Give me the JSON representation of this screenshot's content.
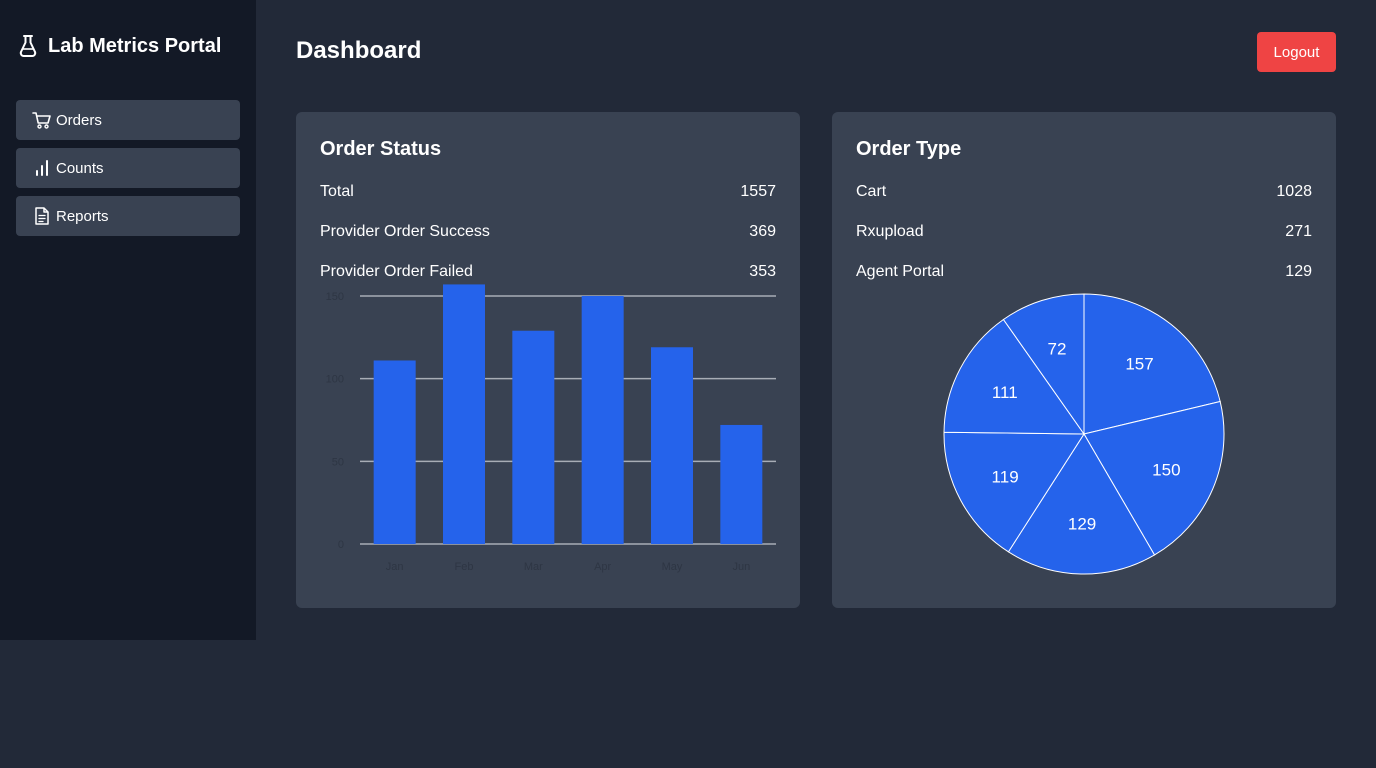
{
  "app": {
    "title": "Lab Metrics Portal",
    "logo_icon": "flask-icon"
  },
  "sidebar": {
    "items": [
      {
        "label": "Orders",
        "icon": "cart-icon"
      },
      {
        "label": "Counts",
        "icon": "bar-chart-icon"
      },
      {
        "label": "Reports",
        "icon": "document-icon"
      }
    ]
  },
  "header": {
    "title": "Dashboard",
    "logout_label": "Logout"
  },
  "colors": {
    "accent": "#2563eb",
    "danger": "#ef4444",
    "card": "#394252",
    "sidebar": "#131926",
    "background": "#222938"
  },
  "order_status": {
    "title": "Order Status",
    "stats": [
      {
        "label": "Total",
        "value": "1557"
      },
      {
        "label": "Provider Order Success",
        "value": "369"
      },
      {
        "label": "Provider Order Failed",
        "value": "353"
      }
    ]
  },
  "order_type": {
    "title": "Order Type",
    "stats": [
      {
        "label": "Cart",
        "value": "1028"
      },
      {
        "label": "Rxupload",
        "value": "271"
      },
      {
        "label": "Agent Portal",
        "value": "129"
      }
    ]
  },
  "chart_data": [
    {
      "type": "bar",
      "categories": [
        "Jan",
        "Feb",
        "Mar",
        "Apr",
        "May",
        "Jun"
      ],
      "values": [
        111,
        157,
        129,
        150,
        119,
        72
      ],
      "yticks": [
        0,
        50,
        100,
        150
      ],
      "ylim": [
        0,
        150
      ],
      "grid": true,
      "color": "#2563eb"
    },
    {
      "type": "pie",
      "values": [
        157,
        150,
        129,
        119,
        111,
        72
      ],
      "color": "#2563eb"
    }
  ]
}
